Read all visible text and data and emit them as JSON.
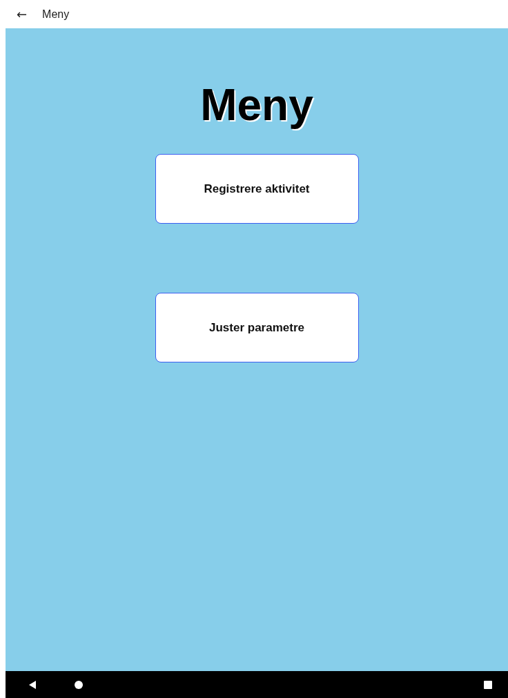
{
  "app_bar": {
    "back": "←",
    "title": "Meny"
  },
  "heading": "Meny",
  "buttons": [
    {
      "label": "Registrere aktivitet"
    },
    {
      "label": "Juster parametre"
    }
  ]
}
